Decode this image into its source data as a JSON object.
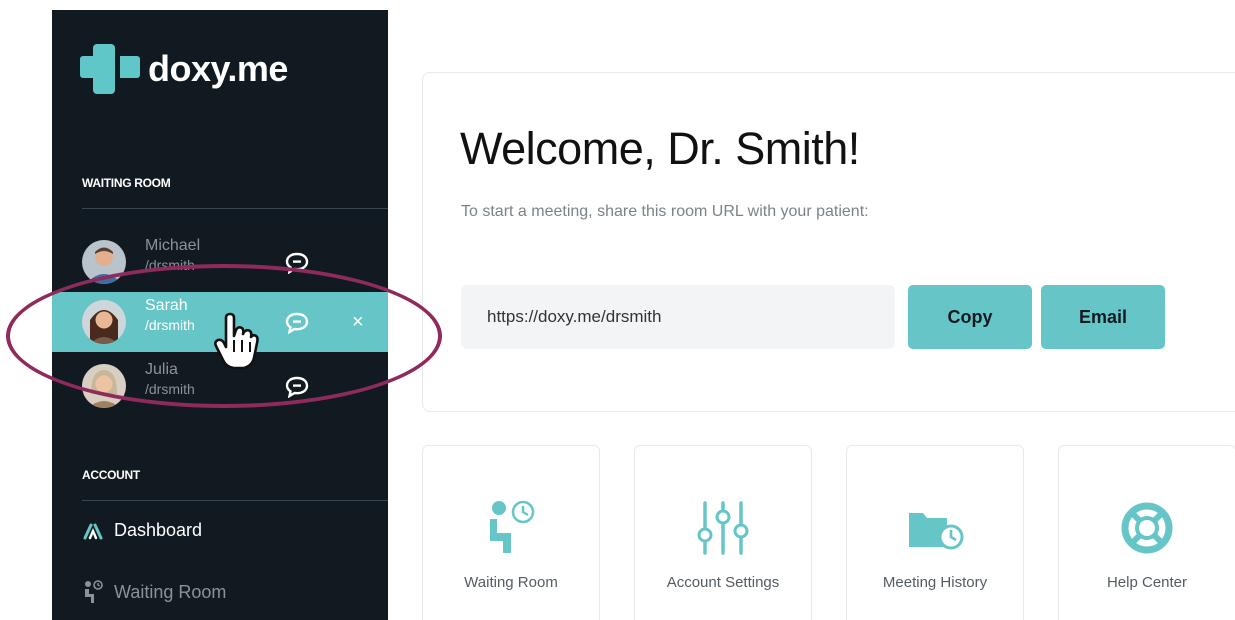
{
  "logo": {
    "text": "doxy.me"
  },
  "sidebar": {
    "waiting_room_title": "WAITING ROOM",
    "account_title": "ACCOUNT",
    "patients": [
      {
        "name": "Michael",
        "room": "/drsmith",
        "state": "dim"
      },
      {
        "name": "Sarah",
        "room": "/drsmith",
        "state": "active"
      },
      {
        "name": "Julia",
        "room": "/drsmith",
        "state": "dim"
      }
    ],
    "close_label": "×",
    "nav": [
      {
        "label": "Dashboard",
        "icon": "gauge-icon"
      },
      {
        "label": "Waiting Room",
        "icon": "waiting-room-icon"
      }
    ]
  },
  "main": {
    "welcome_title": "Welcome, Dr. Smith!",
    "welcome_subtitle": "To start a meeting, share this room URL with your patient:",
    "room_url": "https://doxy.me/drsmith",
    "copy_label": "Copy",
    "email_label": "Email",
    "tiles": [
      {
        "label": "Waiting Room",
        "icon": "waiting-room-icon"
      },
      {
        "label": "Account Settings",
        "icon": "sliders-icon"
      },
      {
        "label": "Meeting History",
        "icon": "folder-clock-icon"
      },
      {
        "label": "Help Center",
        "icon": "lifebuoy-icon"
      }
    ]
  },
  "colors": {
    "accent": "#66c6c7",
    "sidebar_bg": "#111a21",
    "annotation": "#8e2a5c"
  }
}
